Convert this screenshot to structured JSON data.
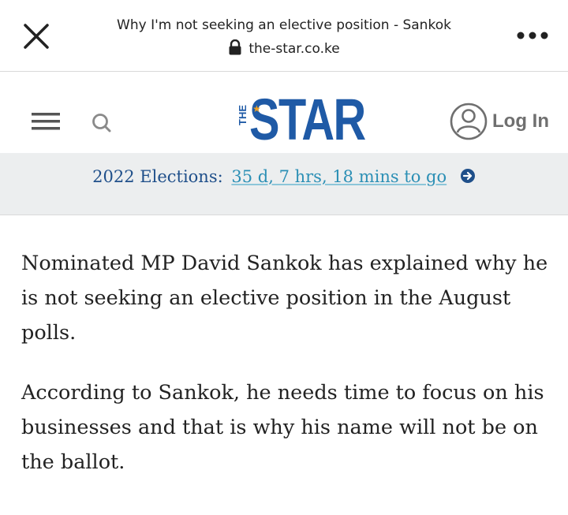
{
  "browser": {
    "title": "Why I'm not seeking an elective position - Sankok",
    "url": "the-star.co.ke",
    "close_icon": "close-icon",
    "lock_icon": "lock-icon",
    "more_icon": "more-dots-icon"
  },
  "header": {
    "menu_icon": "hamburger-menu-icon",
    "search_icon": "search-icon",
    "logo": {
      "prefix": "THE",
      "name": "STAR"
    },
    "login": {
      "icon": "user-avatar-icon",
      "label": "Log In"
    }
  },
  "banner": {
    "lead": "2022 Elections:",
    "countdown": "35 d, 7 hrs, 18 mins to go",
    "arrow_icon": "arrow-circle-right-icon"
  },
  "article": {
    "paragraphs": [
      "Nominated MP David Sankok has explained why he is not seeking an elective position in the August polls.",
      "According to Sankok, he needs time to focus on his businesses and that is why his name will not be on the ballot."
    ]
  },
  "colors": {
    "brand_blue": "#1f5aa6",
    "logo_star_accent": "#f0a020",
    "banner_background": "#eceeef",
    "banner_lead": "#1f4f8a",
    "banner_countdown": "#2b8fb5",
    "login_text": "#6f6f6f"
  }
}
